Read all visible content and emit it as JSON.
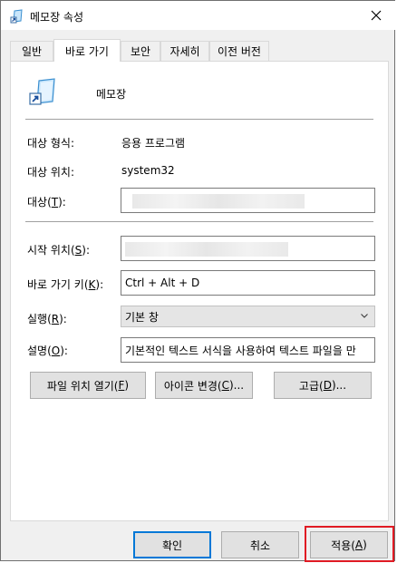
{
  "window": {
    "title": "메모장 속성",
    "icon": "notepad-shortcut-icon"
  },
  "tabs": [
    {
      "label": "일반",
      "active": false
    },
    {
      "label": "바로 가기",
      "active": true
    },
    {
      "label": "보안",
      "active": false
    },
    {
      "label": "자세히",
      "active": false
    },
    {
      "label": "이전 버전",
      "active": false
    }
  ],
  "shortcut": {
    "app_name": "메모장",
    "target_type_label": "대상 형식:",
    "target_type_value": "응용 프로그램",
    "target_location_label": "대상 위치:",
    "target_location_value": "system32",
    "target_label": "대상(",
    "target_key": "T",
    "target_label_end": "):",
    "start_in_label": "시작 위치(",
    "start_in_key": "S",
    "start_in_label_end": "):",
    "hotkey_label": "바로 가기 키(",
    "hotkey_key": "K",
    "hotkey_label_end": "):",
    "hotkey_value": "Ctrl + Alt + D",
    "run_label": "실행(",
    "run_key": "R",
    "run_label_end": "):",
    "run_value": "기본 창",
    "comment_label": "설명(",
    "comment_key": "O",
    "comment_label_end": "):",
    "comment_value": "기본적인 텍스트 서식을 사용하여 텍스트 파일을 만"
  },
  "action_buttons": {
    "open_location": {
      "pre": "파일 위치 열기(",
      "key": "F",
      "post": ")"
    },
    "change_icon": {
      "pre": "아이콘 변경(",
      "key": "C",
      "post": ")..."
    },
    "advanced": {
      "pre": "고급(",
      "key": "D",
      "post": ")..."
    }
  },
  "footer": {
    "ok": "확인",
    "cancel": "취소",
    "apply_pre": "적용(",
    "apply_key": "A",
    "apply_post": ")"
  },
  "colors": {
    "focus_blue": "#0078d7",
    "highlight_red": "#e01b24"
  }
}
